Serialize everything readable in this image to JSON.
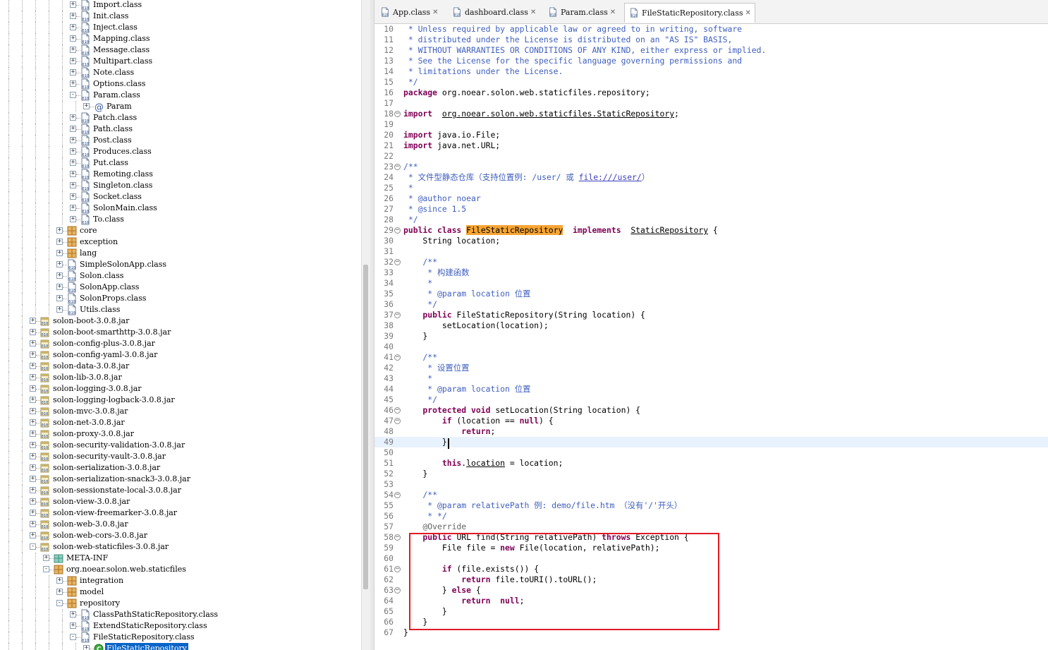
{
  "tree": {
    "rows": [
      {
        "depth": 5,
        "toggle": "+",
        "icon": "class-file-icon",
        "label": "Import.class"
      },
      {
        "depth": 5,
        "toggle": "+",
        "icon": "class-file-icon",
        "label": "Init.class"
      },
      {
        "depth": 5,
        "toggle": "+",
        "icon": "class-file-icon",
        "label": "Inject.class"
      },
      {
        "depth": 5,
        "toggle": "+",
        "icon": "class-file-icon",
        "label": "Mapping.class"
      },
      {
        "depth": 5,
        "toggle": "+",
        "icon": "class-file-icon",
        "label": "Message.class"
      },
      {
        "depth": 5,
        "toggle": "+",
        "icon": "class-file-icon",
        "label": "Multipart.class"
      },
      {
        "depth": 5,
        "toggle": "+",
        "icon": "class-file-icon",
        "label": "Note.class"
      },
      {
        "depth": 5,
        "toggle": "+",
        "icon": "class-file-icon",
        "label": "Options.class"
      },
      {
        "depth": 5,
        "toggle": "-",
        "icon": "class-file-icon",
        "label": "Param.class"
      },
      {
        "depth": 6,
        "toggle": "+",
        "icon": "annotation-icon",
        "label": "Param"
      },
      {
        "depth": 5,
        "toggle": "+",
        "icon": "class-file-icon",
        "label": "Patch.class"
      },
      {
        "depth": 5,
        "toggle": "+",
        "icon": "class-file-icon",
        "label": "Path.class"
      },
      {
        "depth": 5,
        "toggle": "+",
        "icon": "class-file-icon",
        "label": "Post.class"
      },
      {
        "depth": 5,
        "toggle": "+",
        "icon": "class-file-icon",
        "label": "Produces.class"
      },
      {
        "depth": 5,
        "toggle": "+",
        "icon": "class-file-icon",
        "label": "Put.class"
      },
      {
        "depth": 5,
        "toggle": "+",
        "icon": "class-file-icon",
        "label": "Remoting.class"
      },
      {
        "depth": 5,
        "toggle": "+",
        "icon": "class-file-icon",
        "label": "Singleton.class"
      },
      {
        "depth": 5,
        "toggle": "+",
        "icon": "class-file-icon",
        "label": "Socket.class"
      },
      {
        "depth": 5,
        "toggle": "+",
        "icon": "class-file-icon",
        "label": "SolonMain.class"
      },
      {
        "depth": 5,
        "toggle": "+",
        "icon": "class-file-icon",
        "label": "To.class"
      },
      {
        "depth": 4,
        "toggle": "+",
        "icon": "package-icon",
        "label": "core"
      },
      {
        "depth": 4,
        "toggle": "+",
        "icon": "package-icon",
        "label": "exception"
      },
      {
        "depth": 4,
        "toggle": "+",
        "icon": "package-icon",
        "label": "lang"
      },
      {
        "depth": 4,
        "toggle": "+",
        "icon": "class-file-icon",
        "label": "SimpleSolonApp.class"
      },
      {
        "depth": 4,
        "toggle": "+",
        "icon": "class-file-icon",
        "label": "Solon.class"
      },
      {
        "depth": 4,
        "toggle": "+",
        "icon": "class-file-icon",
        "label": "SolonApp.class"
      },
      {
        "depth": 4,
        "toggle": "+",
        "icon": "class-file-icon",
        "label": "SolonProps.class"
      },
      {
        "depth": 4,
        "toggle": "+",
        "icon": "class-file-icon",
        "label": "Utils.class"
      },
      {
        "depth": 2,
        "toggle": "+",
        "icon": "jar-icon",
        "label": "solon-boot-3.0.8.jar"
      },
      {
        "depth": 2,
        "toggle": "+",
        "icon": "jar-icon",
        "label": "solon-boot-smarthttp-3.0.8.jar"
      },
      {
        "depth": 2,
        "toggle": "+",
        "icon": "jar-icon",
        "label": "solon-config-plus-3.0.8.jar"
      },
      {
        "depth": 2,
        "toggle": "+",
        "icon": "jar-icon",
        "label": "solon-config-yaml-3.0.8.jar"
      },
      {
        "depth": 2,
        "toggle": "+",
        "icon": "jar-icon",
        "label": "solon-data-3.0.8.jar"
      },
      {
        "depth": 2,
        "toggle": "+",
        "icon": "jar-icon",
        "label": "solon-lib-3.0.8.jar"
      },
      {
        "depth": 2,
        "toggle": "+",
        "icon": "jar-icon",
        "label": "solon-logging-3.0.8.jar"
      },
      {
        "depth": 2,
        "toggle": "+",
        "icon": "jar-icon",
        "label": "solon-logging-logback-3.0.8.jar"
      },
      {
        "depth": 2,
        "toggle": "+",
        "icon": "jar-icon",
        "label": "solon-mvc-3.0.8.jar"
      },
      {
        "depth": 2,
        "toggle": "+",
        "icon": "jar-icon",
        "label": "solon-net-3.0.8.jar"
      },
      {
        "depth": 2,
        "toggle": "+",
        "icon": "jar-icon",
        "label": "solon-proxy-3.0.8.jar"
      },
      {
        "depth": 2,
        "toggle": "+",
        "icon": "jar-icon",
        "label": "solon-security-validation-3.0.8.jar"
      },
      {
        "depth": 2,
        "toggle": "+",
        "icon": "jar-icon",
        "label": "solon-security-vault-3.0.8.jar"
      },
      {
        "depth": 2,
        "toggle": "+",
        "icon": "jar-icon",
        "label": "solon-serialization-3.0.8.jar"
      },
      {
        "depth": 2,
        "toggle": "+",
        "icon": "jar-icon",
        "label": "solon-serialization-snack3-3.0.8.jar"
      },
      {
        "depth": 2,
        "toggle": "+",
        "icon": "jar-icon",
        "label": "solon-sessionstate-local-3.0.8.jar"
      },
      {
        "depth": 2,
        "toggle": "+",
        "icon": "jar-icon",
        "label": "solon-view-3.0.8.jar"
      },
      {
        "depth": 2,
        "toggle": "+",
        "icon": "jar-icon",
        "label": "solon-view-freemarker-3.0.8.jar"
      },
      {
        "depth": 2,
        "toggle": "+",
        "icon": "jar-icon",
        "label": "solon-web-3.0.8.jar"
      },
      {
        "depth": 2,
        "toggle": "+",
        "icon": "jar-icon",
        "label": "solon-web-cors-3.0.8.jar"
      },
      {
        "depth": 2,
        "toggle": "-",
        "icon": "jar-icon",
        "label": "solon-web-staticfiles-3.0.8.jar"
      },
      {
        "depth": 3,
        "toggle": "+",
        "icon": "folder-icon",
        "label": "META-INF"
      },
      {
        "depth": 3,
        "toggle": "-",
        "icon": "package-icon",
        "label": "org.noear.solon.web.staticfiles"
      },
      {
        "depth": 4,
        "toggle": "+",
        "icon": "package-icon",
        "label": "integration"
      },
      {
        "depth": 4,
        "toggle": "+",
        "icon": "package-icon",
        "label": "model"
      },
      {
        "depth": 4,
        "toggle": "-",
        "icon": "package-icon",
        "label": "repository"
      },
      {
        "depth": 5,
        "toggle": "+",
        "icon": "class-file-icon",
        "label": "ClassPathStaticRepository.class"
      },
      {
        "depth": 5,
        "toggle": "+",
        "icon": "class-file-icon",
        "label": "ExtendStaticRepository.class"
      },
      {
        "depth": 5,
        "toggle": "-",
        "icon": "class-file-icon",
        "label": "FileStaticRepository.class"
      },
      {
        "depth": 6,
        "toggle": "+",
        "icon": "class-icon",
        "label": "FileStaticRepository",
        "selected": true
      }
    ]
  },
  "editor": {
    "tabs": [
      {
        "label": "App.class",
        "icon": "class-file-icon",
        "active": false
      },
      {
        "label": "dashboard.class",
        "icon": "class-file-icon",
        "active": false
      },
      {
        "label": "Param.class",
        "icon": "class-file-icon",
        "active": false
      },
      {
        "label": "FileStaticRepository.class",
        "icon": "class-file-icon",
        "active": true
      }
    ],
    "close_glyph": "✕",
    "lines": [
      {
        "n": "10",
        "tokens": [
          [
            "cm",
            " * Unless required by applicable law or agreed to in writing, software"
          ]
        ]
      },
      {
        "n": "11",
        "tokens": [
          [
            "cm",
            " * distributed under the License is distributed on an \"AS IS\" BASIS,"
          ]
        ]
      },
      {
        "n": "12",
        "tokens": [
          [
            "cm",
            " * WITHOUT WARRANTIES OR CONDITIONS OF ANY KIND, either express or implied."
          ]
        ]
      },
      {
        "n": "13",
        "tokens": [
          [
            "cm",
            " * See the License for the specific language governing permissions and"
          ]
        ]
      },
      {
        "n": "14",
        "tokens": [
          [
            "cm",
            " * limitations under the License."
          ]
        ]
      },
      {
        "n": "15",
        "tokens": [
          [
            "cm",
            " */"
          ]
        ]
      },
      {
        "n": "16",
        "tokens": [
          [
            "kw",
            "package"
          ],
          [
            "",
            "org.noear.solon.web.staticfiles.repository;"
          ]
        ]
      },
      {
        "n": "17",
        "tokens": []
      },
      {
        "n": "18",
        "fold": true,
        "tokens": [
          [
            "kw",
            "import"
          ],
          [
            "",
            ""
          ],
          [
            "ul",
            "org.noear.solon.web.staticfiles.StaticRepository"
          ],
          [
            "",
            ";"
          ]
        ]
      },
      {
        "n": "19",
        "tokens": []
      },
      {
        "n": "20",
        "tokens": [
          [
            "kw",
            "import"
          ],
          [
            "",
            "java.io.File;"
          ]
        ]
      },
      {
        "n": "21",
        "tokens": [
          [
            "kw",
            "import"
          ],
          [
            "",
            "java.net.URL;"
          ]
        ]
      },
      {
        "n": "22",
        "tokens": []
      },
      {
        "n": "23",
        "fold": true,
        "tokens": [
          [
            "cm",
            "/**"
          ]
        ]
      },
      {
        "n": "24",
        "tokens": [
          [
            "cm",
            " * 文件型静态仓库（支持位置例: /user/ 或 "
          ],
          [
            "lk",
            "file:///user/"
          ],
          [
            "cm",
            "）"
          ]
        ]
      },
      {
        "n": "25",
        "tokens": [
          [
            "cm",
            " *"
          ]
        ]
      },
      {
        "n": "26",
        "tokens": [
          [
            "cm",
            " * @author noear"
          ]
        ]
      },
      {
        "n": "27",
        "tokens": [
          [
            "cm",
            " * @since 1.5"
          ]
        ]
      },
      {
        "n": "28",
        "tokens": [
          [
            "cm",
            " */"
          ]
        ]
      },
      {
        "n": "29",
        "fold": true,
        "tokens": [
          [
            "kw",
            "public class"
          ],
          [
            "hl",
            "FileStaticRepository"
          ],
          [
            "",
            ""
          ],
          [
            "kw",
            "implements"
          ],
          [
            "",
            ""
          ],
          [
            "ul",
            "StaticRepository"
          ],
          [
            "",
            " {"
          ]
        ]
      },
      {
        "n": "30",
        "tokens": [
          [
            "",
            "    String location;"
          ]
        ]
      },
      {
        "n": "31",
        "tokens": []
      },
      {
        "n": "32",
        "fold": true,
        "tokens": [
          [
            "cm",
            "    /**"
          ]
        ]
      },
      {
        "n": "33",
        "tokens": [
          [
            "cm",
            "     * 构建函数"
          ]
        ]
      },
      {
        "n": "34",
        "tokens": [
          [
            "cm",
            "     *"
          ]
        ]
      },
      {
        "n": "35",
        "tokens": [
          [
            "cm",
            "     * @param location 位置"
          ]
        ]
      },
      {
        "n": "36",
        "tokens": [
          [
            "cm",
            "     */"
          ]
        ]
      },
      {
        "n": "37",
        "fold": true,
        "tokens": [
          [
            "kw",
            "    public"
          ],
          [
            "",
            "FileStaticRepository(String location) {"
          ]
        ]
      },
      {
        "n": "38",
        "tokens": [
          [
            "",
            "        setLocation(location);"
          ]
        ]
      },
      {
        "n": "39",
        "tokens": [
          [
            "",
            "    }"
          ]
        ]
      },
      {
        "n": "40",
        "tokens": []
      },
      {
        "n": "41",
        "fold": true,
        "tokens": [
          [
            "cm",
            "    /**"
          ]
        ]
      },
      {
        "n": "42",
        "tokens": [
          [
            "cm",
            "     * 设置位置"
          ]
        ]
      },
      {
        "n": "43",
        "tokens": [
          [
            "cm",
            "     *"
          ]
        ]
      },
      {
        "n": "44",
        "tokens": [
          [
            "cm",
            "     * @param location 位置"
          ]
        ]
      },
      {
        "n": "45",
        "tokens": [
          [
            "cm",
            "     */"
          ]
        ]
      },
      {
        "n": "46",
        "fold": true,
        "tokens": [
          [
            "kw",
            "    protected void"
          ],
          [
            "",
            "setLocation(String location) {"
          ]
        ]
      },
      {
        "n": "47",
        "fold": true,
        "tokens": [
          [
            "kw",
            "        if"
          ],
          [
            "",
            " (location == "
          ],
          [
            "kw",
            "null"
          ],
          [
            "",
            ") {"
          ]
        ]
      },
      {
        "n": "48",
        "tokens": [
          [
            "kw",
            "            return"
          ],
          [
            "",
            ";"
          ]
        ]
      },
      {
        "n": "49",
        "current": true,
        "tokens": [
          [
            "",
            "        }"
          ]
        ]
      },
      {
        "n": "50",
        "tokens": []
      },
      {
        "n": "51",
        "tokens": [
          [
            "kw",
            "        this"
          ],
          [
            "",
            "."
          ],
          [
            "ul",
            "location"
          ],
          [
            "",
            " = location;"
          ]
        ]
      },
      {
        "n": "52",
        "tokens": [
          [
            "",
            "    }"
          ]
        ]
      },
      {
        "n": "53",
        "tokens": []
      },
      {
        "n": "54",
        "fold": true,
        "tokens": [
          [
            "cm",
            "    /**"
          ]
        ]
      },
      {
        "n": "55",
        "tokens": [
          [
            "cm",
            "     * @param relativePath 例: demo/file.htm （没有'/'开头）"
          ]
        ]
      },
      {
        "n": "56",
        "tokens": [
          [
            "cm",
            "     * */"
          ]
        ]
      },
      {
        "n": "57",
        "tokens": [
          [
            "an",
            "    @Override"
          ]
        ]
      },
      {
        "n": "58",
        "fold": true,
        "tokens": [
          [
            "kw",
            "    public"
          ],
          [
            "",
            "URL find(String relativePath)"
          ],
          [
            "kw",
            "throws"
          ],
          [
            "",
            "Exception {"
          ]
        ]
      },
      {
        "n": "59",
        "tokens": [
          [
            "",
            "        File file = "
          ],
          [
            "kw",
            "new"
          ],
          [
            "",
            "File(location, relativePath);"
          ]
        ]
      },
      {
        "n": "60",
        "tokens": []
      },
      {
        "n": "61",
        "fold": true,
        "tokens": [
          [
            "kw",
            "        if"
          ],
          [
            "",
            " (file.exists()) {"
          ]
        ]
      },
      {
        "n": "62",
        "tokens": [
          [
            "kw",
            "            return"
          ],
          [
            "",
            "file.toURI().toURL();"
          ]
        ]
      },
      {
        "n": "63",
        "fold": true,
        "tokens": [
          [
            "",
            "        } "
          ],
          [
            "kw",
            "else"
          ],
          [
            "",
            " {"
          ]
        ]
      },
      {
        "n": "64",
        "tokens": [
          [
            "kw",
            "            return"
          ],
          [
            "",
            ""
          ],
          [
            "kw",
            "null"
          ],
          [
            "",
            ";"
          ]
        ]
      },
      {
        "n": "65",
        "tokens": [
          [
            "",
            "        }"
          ]
        ]
      },
      {
        "n": "66",
        "tokens": [
          [
            "",
            "    }"
          ]
        ]
      },
      {
        "n": "67",
        "tokens": [
          [
            "",
            "}"
          ]
        ]
      }
    ]
  },
  "colors": {
    "keyword": "#7f0055",
    "comment": "#3f5fbf",
    "annotation": "#646464",
    "highlight": "#f7a532",
    "selection": "#0a64c8",
    "redbox": "#e01b24"
  }
}
